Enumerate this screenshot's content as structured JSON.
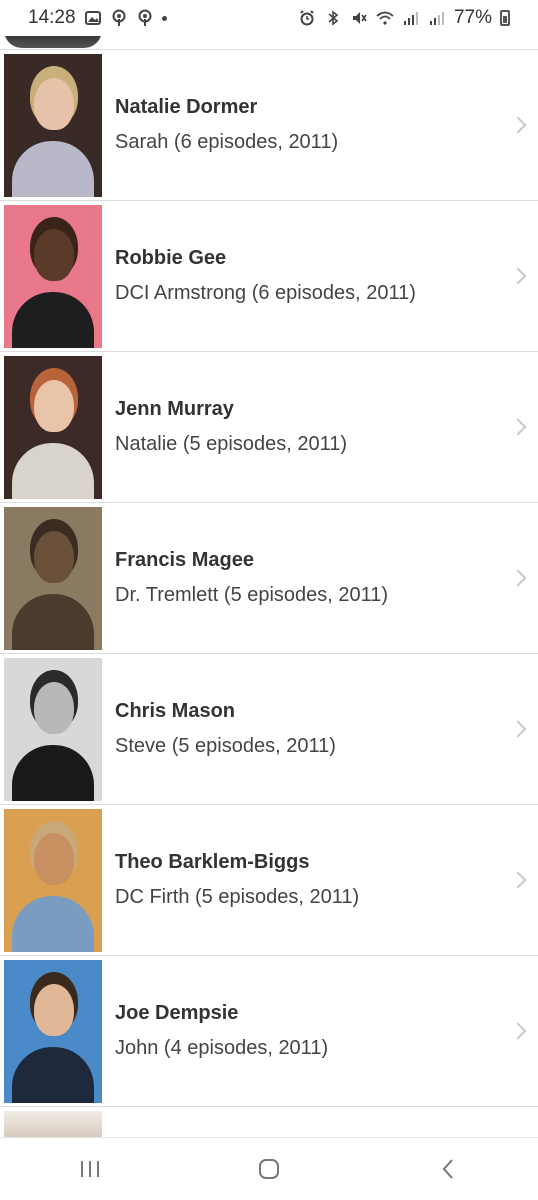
{
  "status_bar": {
    "time": "14:28",
    "battery": "77%"
  },
  "cast": [
    {
      "name": "Natalie Dormer",
      "role": "Sarah (6 episodes, 2011)",
      "thumb_bg": "#3a2a26",
      "skin": "#e6c3a8",
      "hair": "#c9b07a",
      "clothes": "#b8b8c8"
    },
    {
      "name": "Robbie Gee",
      "role": "DCI Armstrong (6 episodes, 2011)",
      "thumb_bg": "#e8788a",
      "skin": "#5a3a28",
      "hair": "#3a2418",
      "clothes": "#1e1e1e"
    },
    {
      "name": "Jenn Murray",
      "role": "Natalie (5 episodes, 2011)",
      "thumb_bg": "#3c2a26",
      "skin": "#e8c4a8",
      "hair": "#b8643a",
      "clothes": "#d8d4cc"
    },
    {
      "name": "Francis Magee",
      "role": "Dr. Tremlett (5 episodes, 2011)",
      "thumb_bg": "#8a7a62",
      "skin": "#6a5038",
      "hair": "#3a2c20",
      "clothes": "#4a3c2c"
    },
    {
      "name": "Chris Mason",
      "role": "Steve (5 episodes, 2011)",
      "thumb_bg": "#d8d8d8",
      "skin": "#b8b8b8",
      "hair": "#2a2a2a",
      "clothes": "#1a1a1a"
    },
    {
      "name": "Theo Barklem-Biggs",
      "role": "DC Firth (5 episodes, 2011)",
      "thumb_bg": "#d8a050",
      "skin": "#c89060",
      "hair": "#c8a878",
      "clothes": "#7a9cc0"
    },
    {
      "name": "Joe Dempsie",
      "role": "John (4 episodes, 2011)",
      "thumb_bg": "#4a8ac8",
      "skin": "#e0b898",
      "hair": "#3a2a1e",
      "clothes": "#1e2a3c"
    }
  ]
}
